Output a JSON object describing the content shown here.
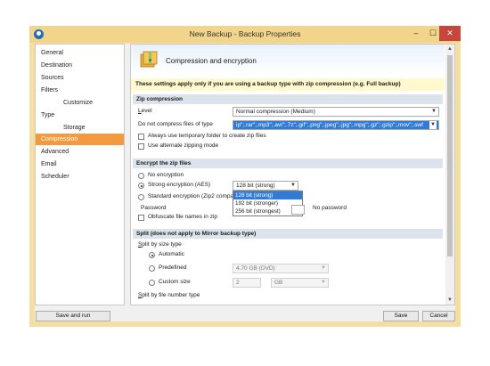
{
  "window": {
    "title": "New Backup - Backup Properties",
    "controls": {
      "minimize": "–",
      "maximize": "☐",
      "close": "✕"
    }
  },
  "sidebar": {
    "items": [
      {
        "label": "General"
      },
      {
        "label": "Destination"
      },
      {
        "label": "Sources"
      },
      {
        "label": "Filters"
      },
      {
        "label": "Customize"
      },
      {
        "label": "Type"
      },
      {
        "label": "Storage"
      },
      {
        "label": "Compression"
      },
      {
        "label": "Advanced"
      },
      {
        "label": "Email"
      },
      {
        "label": "Scheduler"
      }
    ],
    "active": "Compression"
  },
  "header": {
    "title": "Compression and encryption",
    "icon": "zip-archive-icon"
  },
  "note": "These settings apply only if you are using a backup type with zip compression (e.g. Full backup)",
  "zip": {
    "section": "Zip compression",
    "level_label": "Level",
    "level_value": "Normal compression (Medium)",
    "nocompress_label": "Do not compress files of type",
    "nocompress_value": "ip\";.rar\";.mp3\";.avi\";.7z\";.gif\";.png\";.jpeg\";.jpg\";.mpg\";.gz\";.gzip\";.mov\";.swf",
    "temp_folder_label": "Always use temporary folder to create zip files",
    "alt_zip_label": "Use alternate zipping mode"
  },
  "encrypt": {
    "section": "Encrypt the zip files",
    "no_encryption": "No encryption",
    "strong": "Strong encryption (AES)",
    "strong_value": "128 bit (strong)",
    "options": [
      "128 bit (strong)",
      "192 bit (stronger)",
      "256 bit (strongest)"
    ],
    "standard": "Standard encryption (Zip2 compa",
    "password_label": "Password",
    "no_password": "No password",
    "obfuscate": "Obfuscate file names in zip"
  },
  "split": {
    "section": "Split (does not apply to Mirror backup type)",
    "by_size_label": "Split by size type",
    "automatic": "Automatic",
    "predefined": "Predefined",
    "predefined_value": "4.70 GB (DVD)",
    "custom": "Custom size",
    "custom_value": "2",
    "custom_unit": "GB",
    "by_number_label": "Split by file number type"
  },
  "buttons": {
    "save_and_run": "Save and run",
    "save": "Save",
    "cancel": "Cancel"
  }
}
